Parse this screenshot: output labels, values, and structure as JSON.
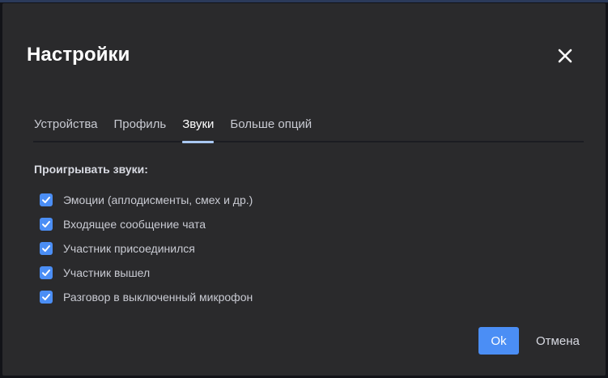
{
  "dialog": {
    "title": "Настройки",
    "close_icon": "close-icon"
  },
  "tabs": [
    {
      "label": "Устройства",
      "active": false
    },
    {
      "label": "Профиль",
      "active": false
    },
    {
      "label": "Звуки",
      "active": true
    },
    {
      "label": "Больше опций",
      "active": false
    }
  ],
  "sounds": {
    "section_label": "Проигрывать звуки:",
    "options": [
      {
        "label": "Эмоции (аплодисменты, смех и др.)",
        "checked": true
      },
      {
        "label": "Входящее сообщение чата",
        "checked": true
      },
      {
        "label": "Участник присоединился",
        "checked": true
      },
      {
        "label": "Участник вышел",
        "checked": true
      },
      {
        "label": "Разговор в выключенный микрофон",
        "checked": true
      }
    ]
  },
  "footer": {
    "ok_label": "Ok",
    "cancel_label": "Отмена"
  },
  "colors": {
    "accent": "#4b8ef5",
    "dialog_bg": "#2a2a2c",
    "tab_indicator": "#a9c8f2"
  }
}
